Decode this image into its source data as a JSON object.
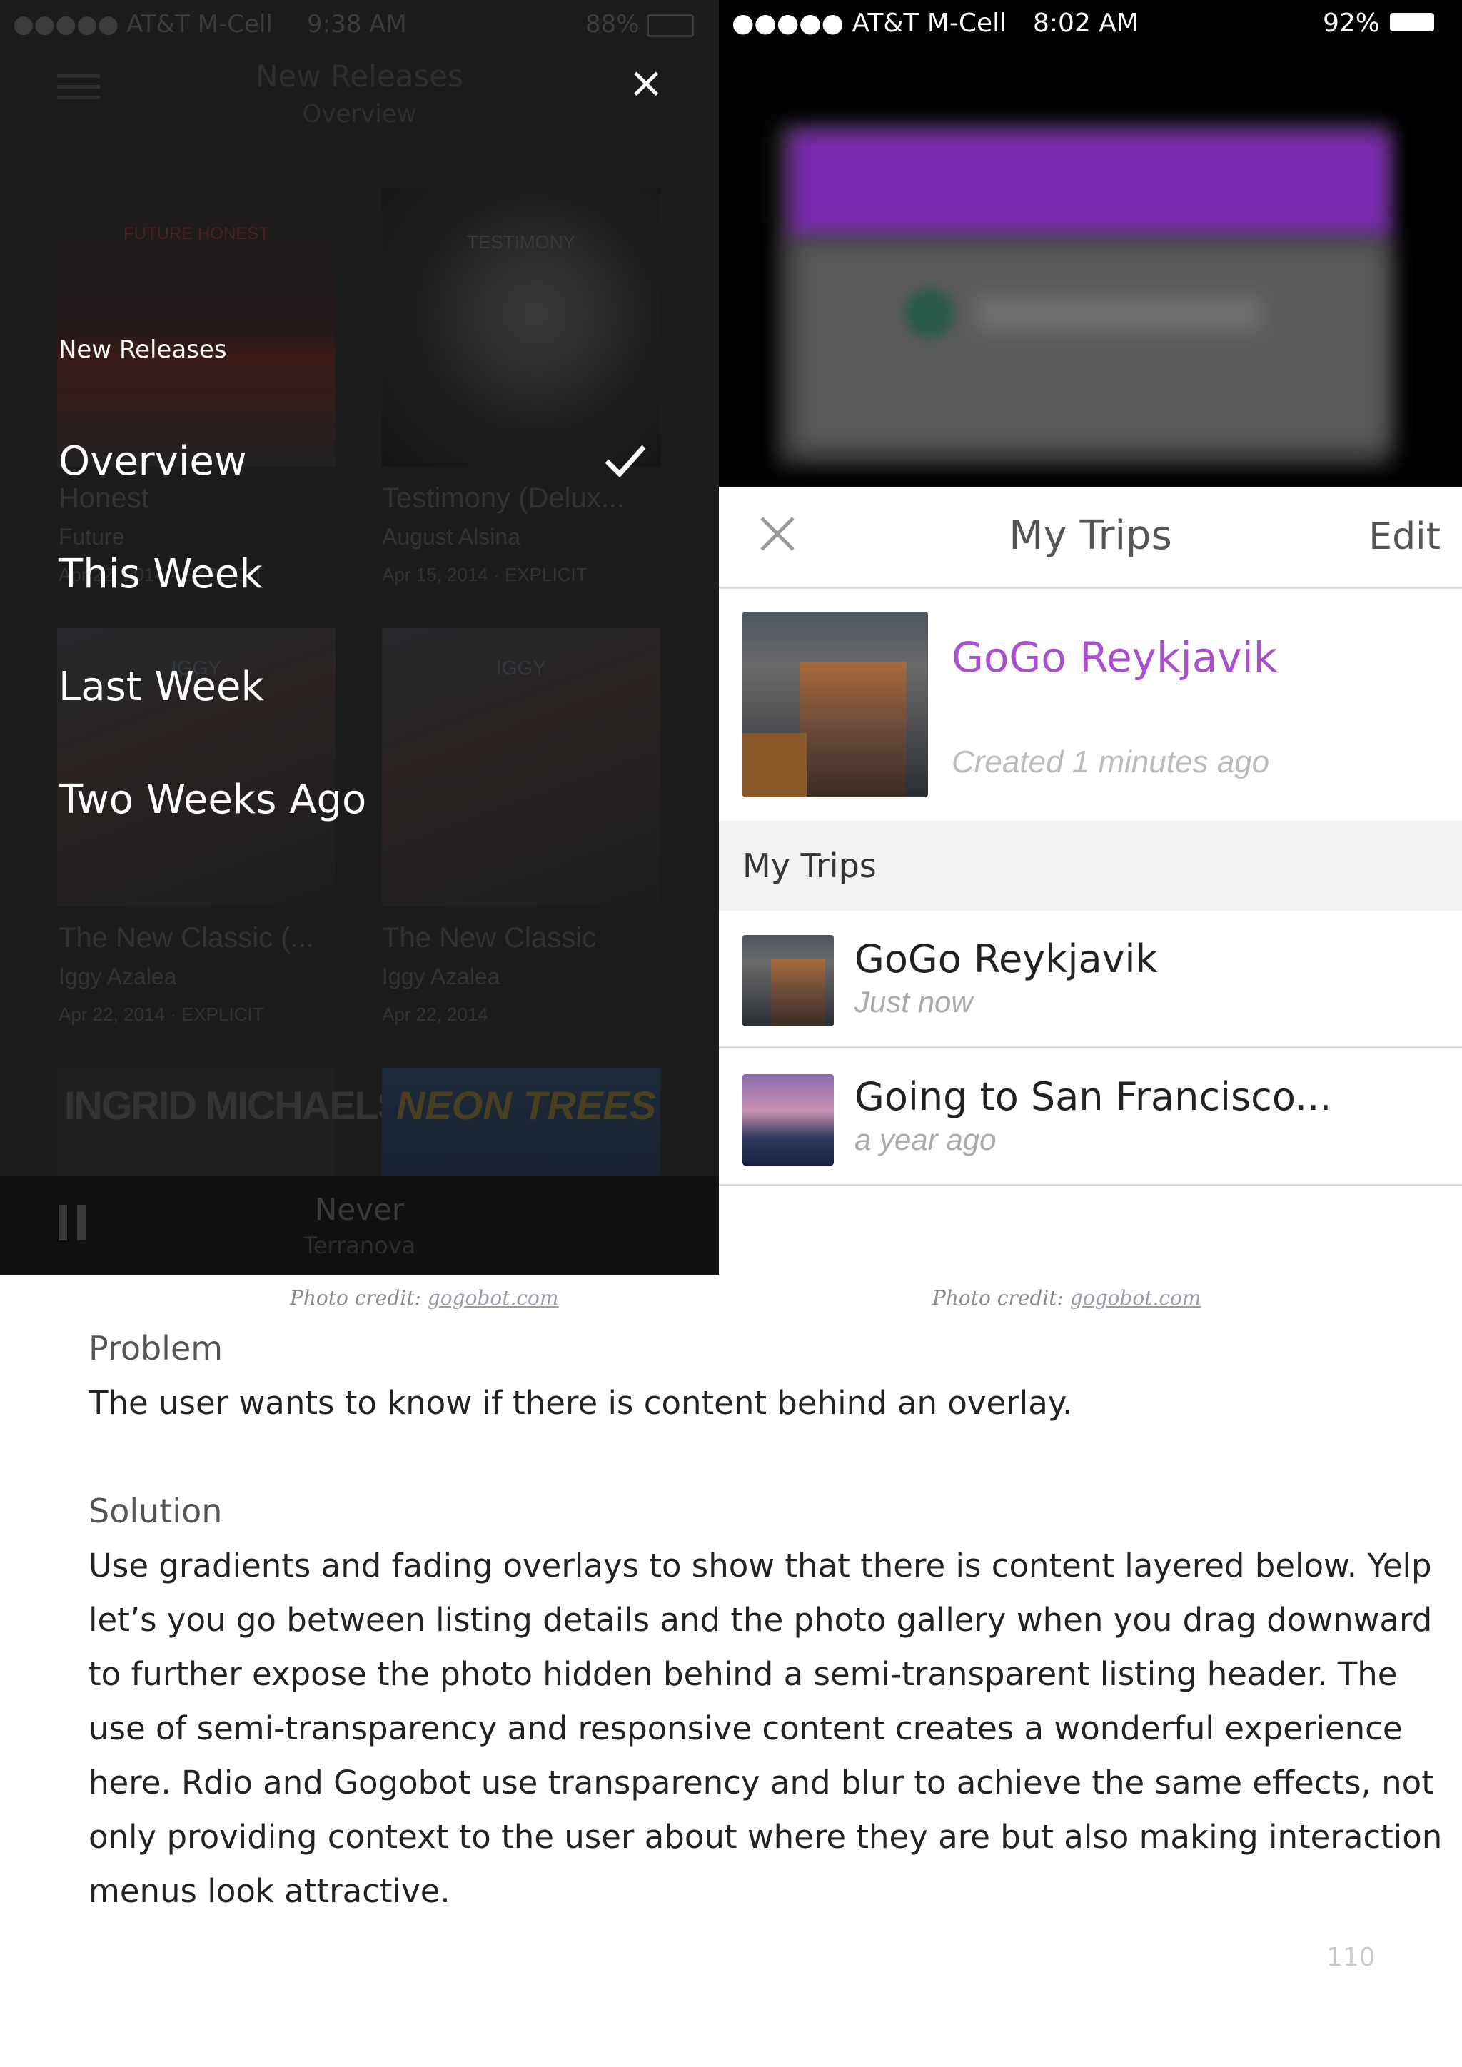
{
  "left_phone": {
    "status": {
      "carrier": "●●●●● AT&T M-Cell",
      "time": "9:38 AM",
      "battery": "88%"
    },
    "header": {
      "title": "New Releases",
      "subtitle": "Overview"
    },
    "close_icon": "×",
    "albums": [
      {
        "title": "Honest",
        "artist": "Future",
        "meta": "Apr 22, 2014 · EXPLICIT",
        "cover_text": "FUTURE HONEST"
      },
      {
        "title": "Testimony (Delux...",
        "artist": "August Alsina",
        "meta": "Apr 15, 2014 · EXPLICIT",
        "cover_text": "TESTIMONY"
      },
      {
        "title": "The New Classic (...",
        "artist": "Iggy Azalea",
        "meta": "Apr 22, 2014 · EXPLICIT",
        "cover_text": "IGGY"
      },
      {
        "title": "The New Classic",
        "artist": "Iggy Azalea",
        "meta": "Apr 22, 2014",
        "cover_text": "IGGY"
      },
      {
        "title": "",
        "artist": "",
        "meta": "",
        "cover_text": "INGRID MICHAELSON"
      },
      {
        "title": "",
        "artist": "",
        "meta": "",
        "cover_text": "NEON TREES"
      }
    ],
    "menu": {
      "section_label": "New Releases",
      "items": [
        "Overview",
        "This Week",
        "Last Week",
        "Two Weeks Ago"
      ],
      "selected_index": 0
    },
    "player": {
      "track": "Never",
      "artist": "Terranova"
    }
  },
  "right_phone": {
    "status": {
      "carrier": "●●●●● AT&T M-Cell",
      "time": "8:02 AM",
      "battery": "92%"
    },
    "nav": {
      "title": "My Trips",
      "edit": "Edit",
      "close_icon": "×"
    },
    "featured": {
      "title": "GoGo Reykjavik",
      "created": "Created 1 minutes ago"
    },
    "section": "My Trips",
    "trips": [
      {
        "name": "GoGo Reykjavik",
        "time": "Just now"
      },
      {
        "name": "Going to San Francisco...",
        "time": "a year ago"
      }
    ]
  },
  "captions": {
    "prefix": "Photo credit:",
    "link": "gogobot.com"
  },
  "problem": {
    "heading": "Problem",
    "text": "The user wants to know if there is content behind an overlay."
  },
  "solution": {
    "heading": "Solution",
    "text": "Use gradients and fading overlays to show that there is content layered below.  Yelp let’s you go between listing details and the photo gallery when you drag downward to further expose the photo hidden behind a semi-transparent listing header. The use of semi-transparency and responsive content creates a wonderful experience here. Rdio and Gogobot use transparency and blur to achieve the same effects, not only providing context to the user about where they are but also making interaction menus look attractive."
  },
  "page_number": "110",
  "colors": {
    "accent_purple": "#a94fd0",
    "overlay_dark": "#1c1c1c",
    "section_bg": "#f2f2f4"
  }
}
